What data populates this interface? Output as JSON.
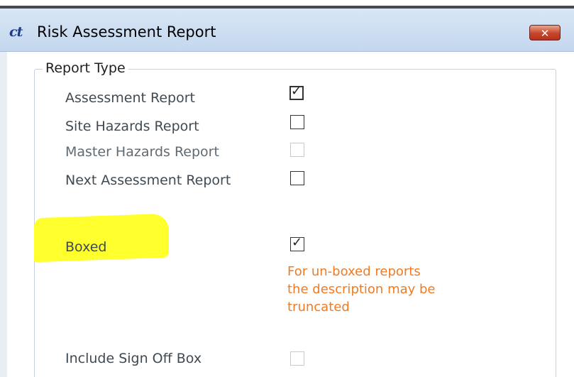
{
  "window": {
    "title": "Risk Assessment Report",
    "app_icon_text": "ct",
    "close_symbol": "✕"
  },
  "group": {
    "legend": "Report Type"
  },
  "options": [
    {
      "label": "Assessment Report",
      "checked": true,
      "enabled": true
    },
    {
      "label": "Site Hazards Report",
      "checked": false,
      "enabled": true
    },
    {
      "label": "Master Hazards Report",
      "checked": false,
      "enabled": false
    },
    {
      "label": "Next Assessment Report",
      "checked": false,
      "enabled": true
    },
    {
      "label": "Boxed",
      "checked": true,
      "enabled": true,
      "highlighted": true
    },
    {
      "label": "Include Sign Off Box",
      "checked": false,
      "enabled": false
    }
  ],
  "warning_lines": [
    "For un-boxed reports",
    "the description may be",
    "truncated"
  ],
  "colors": {
    "warning": "#f07b24",
    "highlight": "#ffff2e",
    "title_bar": "#c4d7ee",
    "close_button": "#c7442c"
  },
  "icons": {
    "check": "✓"
  }
}
